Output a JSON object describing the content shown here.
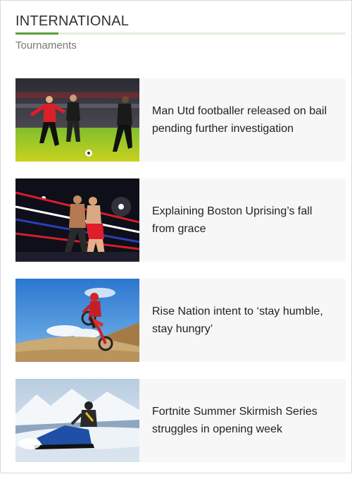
{
  "section": {
    "title": "INTERNATIONAL",
    "subtitle": "Tournaments",
    "accent_color": "#5aa03a"
  },
  "articles": [
    {
      "headline": "Man Utd footballer released on bail pending further investigation",
      "image": "football-match-photo"
    },
    {
      "headline": "Explaining Boston Uprising’s fall from grace",
      "image": "boxing-ring-photo"
    },
    {
      "headline": "Rise Nation intent to ‘stay humble, stay hungry’",
      "image": "motocross-jump-photo"
    },
    {
      "headline": "Fortnite Summer Skirmish Series struggles in opening week",
      "image": "snowmobile-mountain-photo"
    }
  ]
}
